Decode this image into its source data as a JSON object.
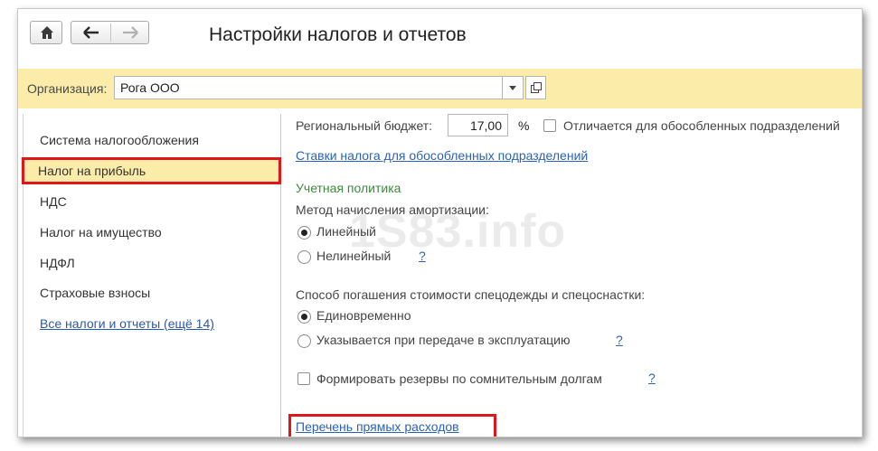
{
  "window": {
    "title": "Настройки налогов и отчетов",
    "icons": {
      "home": "home-icon",
      "back": "arrow-left-icon",
      "forward": "arrow-right-icon"
    }
  },
  "org_bar": {
    "label": "Организация:",
    "value": "Рога ООО",
    "icons": {
      "dropdown": "chevron-down-icon",
      "open": "open-window-icon"
    }
  },
  "sidebar": {
    "items": [
      {
        "label": "Система налогообложения",
        "active": false
      },
      {
        "label": "Налог на прибыль",
        "active": true
      },
      {
        "label": "НДС",
        "active": false
      },
      {
        "label": "Налог на имущество",
        "active": false
      },
      {
        "label": "НДФЛ",
        "active": false
      },
      {
        "label": "Страховые взносы",
        "active": false
      }
    ],
    "all_link": "Все налоги и отчеты (ещё 14)"
  },
  "main": {
    "regional_budget_label": "Региональный бюджет:",
    "regional_budget_value": "17,00",
    "percent_sign": "%",
    "differs_checkbox_label": "Отличается для обособленных подразделений",
    "differs_checked": false,
    "rates_link": "Ставки налога для обособленных подразделений",
    "accounting_policy_heading": "Учетная политика",
    "depreciation_label": "Метод начисления амортизации:",
    "depreciation_options": [
      {
        "label": "Линейный",
        "selected": true
      },
      {
        "label": "Нелинейный",
        "selected": false
      }
    ],
    "workwear_label": "Способ погашения стоимости спецодежды и спецоснастки:",
    "workwear_options": [
      {
        "label": "Единовременно",
        "selected": true
      },
      {
        "label": "Указывается при передаче в эксплуатацию",
        "selected": false
      }
    ],
    "reserves_checkbox_label": "Формировать резервы по сомнительным долгам",
    "reserves_checked": false,
    "help_mark": "?",
    "direct_costs_link": "Перечень прямых расходов",
    "watermark": "1S83.info"
  },
  "colors": {
    "highlight_bar": "#fbeca9",
    "annotation_red": "#e0161b",
    "link_blue": "#2b63b4",
    "heading_green": "#3c8a3c"
  }
}
